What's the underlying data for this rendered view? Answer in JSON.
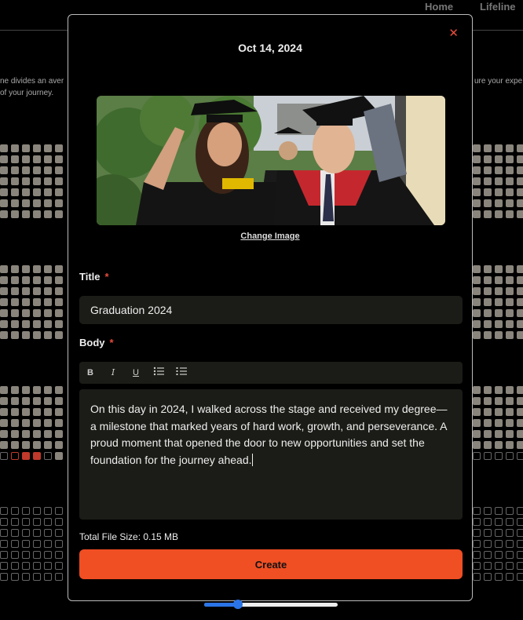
{
  "nav": {
    "home": "Home",
    "lifeline": "Lifeline"
  },
  "background": {
    "left_text_1": "ne divides an aver",
    "left_text_2": "of your journey.",
    "right_text": "ure your expe"
  },
  "modal": {
    "date": "Oct 14, 2024",
    "close_icon": "close-icon",
    "image_alt": "graduation-photo",
    "change_image": "Change Image",
    "title_label": "Title",
    "title_value": "Graduation 2024",
    "body_label": "Body",
    "required_mark": "*",
    "toolbar": {
      "bold": "B",
      "italic": "I",
      "underline": "U",
      "bullet_list": "bullet-list-icon",
      "numbered_list": "numbered-list-icon"
    },
    "body_text": "On this day in 2024, I walked across the stage and received my degree—a milestone that marked years of hard work, growth, and perseverance. A proud moment that opened the door to new opportunities and set the foundation for the journey ahead.",
    "file_size_text": "Total File Size: 0.15 MB",
    "create_label": "Create"
  },
  "slider": {
    "value": 0.25
  },
  "colors": {
    "accent": "#f04e23",
    "close": "#e74c3c",
    "slider": "#2b74e8",
    "field_bg": "#1b1c17"
  }
}
